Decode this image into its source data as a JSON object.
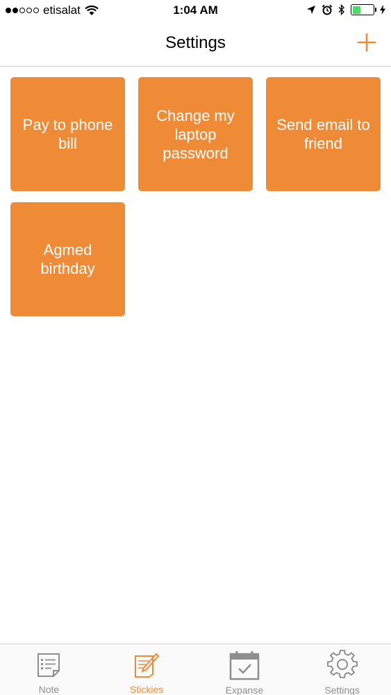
{
  "status_bar": {
    "carrier": "etisalat",
    "time": "1:04 AM"
  },
  "header": {
    "title": "Settings"
  },
  "stickies": [
    {
      "text": "Pay to phone bill"
    },
    {
      "text": "Change my laptop password"
    },
    {
      "text": "Send email to friend"
    },
    {
      "text": "Agmed birthday"
    }
  ],
  "tabs": [
    {
      "label": "Note",
      "icon": "note-icon",
      "active": false
    },
    {
      "label": "Stickies",
      "icon": "stickies-icon",
      "active": true
    },
    {
      "label": "Expanse",
      "icon": "calendar-icon",
      "active": false
    },
    {
      "label": "Settings",
      "icon": "gear-icon",
      "active": false
    }
  ],
  "colors": {
    "accent": "#ef8a37",
    "inactive": "#8e8e8e",
    "battery": "#4cd964"
  }
}
